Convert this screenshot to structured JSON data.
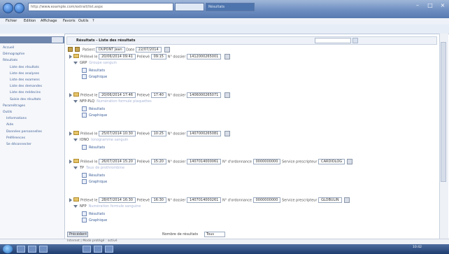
{
  "browser": {
    "address": "http://www.example.com/extrait/list.aspx",
    "tab_title": "Résultats",
    "menu": [
      "Fichier",
      "Edition",
      "Affichage",
      "Favoris",
      "Outils",
      "?"
    ]
  },
  "sidebar": {
    "items": [
      {
        "label": "Accueil",
        "indent": 0
      },
      {
        "label": "Démographie",
        "indent": 0
      },
      {
        "label": "Résultats",
        "indent": 0
      },
      {
        "label": "Liste des résultats",
        "indent": 2
      },
      {
        "label": "Liste des analyses",
        "indent": 2
      },
      {
        "label": "Liste des examens",
        "indent": 2
      },
      {
        "label": "Liste des demandes",
        "indent": 2
      },
      {
        "label": "Liste des médecins",
        "indent": 2
      },
      {
        "label": "Saisie des résultats",
        "indent": 2
      },
      {
        "label": "Paramétrages",
        "indent": 0
      },
      {
        "label": "Outils",
        "indent": 0
      },
      {
        "label": "Informations",
        "indent": 1
      },
      {
        "label": "Aide",
        "indent": 1
      },
      {
        "label": "Données personnelles",
        "indent": 1
      },
      {
        "label": "Préférences",
        "indent": 1
      },
      {
        "label": "Se déconnecter",
        "indent": 1
      }
    ]
  },
  "main": {
    "title": "Résultats - Liste des résultats",
    "filters": {
      "patient_label": "Patient",
      "patient_value": "DUPONT Jean",
      "date_label": "Date",
      "date_value": "22/07/2014"
    },
    "records": [
      {
        "date_label": "Prélevé le",
        "date": "20/06/2014 09:41",
        "time_label": "Prélevé",
        "time": "09:15",
        "num_label": "N° dossier",
        "num": "1412000265001",
        "code": "GRP",
        "link": "Groupe sanguin",
        "items": [
          "Résultats",
          "Graphique"
        ]
      },
      {
        "date_label": "Prélevé le",
        "date": "20/06/2014 17:46",
        "time_label": "Prélevé",
        "time": "17:40",
        "num_label": "N° dossier",
        "num": "1406000265071",
        "code": "NFP-PLQ",
        "link": "Numération formule plaquettes",
        "items": [
          "Résultats",
          "Graphique"
        ]
      },
      {
        "date_label": "Prélevé le",
        "date": "25/07/2014 10:30",
        "time_label": "Prélevé",
        "time": "10:25",
        "num_label": "N° dossier",
        "num": "1407000265081",
        "code": "IONO",
        "link": "Ionogramme sanguin",
        "items": [
          "Résultats"
        ]
      },
      {
        "date_label": "Prélevé le",
        "date": "26/07/2014 15:20",
        "time_label": "Prélevé",
        "time": "15:20",
        "num_label": "N° dossier",
        "num": "1407014000061",
        "extra_label": "N° d'ordonnance",
        "extra": "0000000000",
        "extra2_label": "Service prescripteur",
        "extra2": "CARDIOLOG",
        "code": "TP",
        "link": "Taux de prothrombine",
        "items": [
          "Résultats",
          "Graphique"
        ]
      },
      {
        "date_label": "Prélevé le",
        "date": "28/07/2014 16:30",
        "time_label": "Prélevé",
        "time": "16:30",
        "num_label": "N° dossier",
        "num": "1407014000261",
        "extra_label": "N° d'ordonnance",
        "extra": "0000000000",
        "extra2_label": "Service prescripteur",
        "extra2": "GLOBULIN",
        "code": "NFP",
        "link": "Numération formule sanguine",
        "items": [
          "Résultats",
          "Graphique"
        ]
      }
    ]
  },
  "pager": {
    "button": "Précédent",
    "label": "Nombre de résultats",
    "value": "Tous"
  },
  "status": "Internet | Mode protégé : activé",
  "clock": "10:42"
}
